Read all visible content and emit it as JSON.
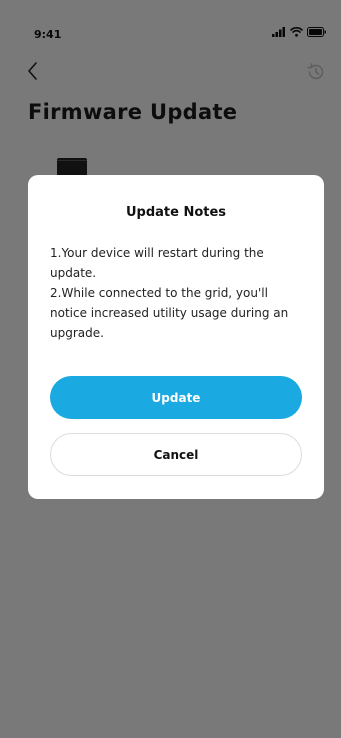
{
  "status_bar": {
    "time": "9:41",
    "icons": [
      "signal-icon",
      "wifi-icon",
      "battery-icon"
    ]
  },
  "nav": {
    "back_icon": "chevron-left-icon",
    "history_icon": "history-icon"
  },
  "page": {
    "title": "Firmware Update"
  },
  "dialog": {
    "title": "Update Notes",
    "notes": [
      "1.Your device will restart during the update.",
      "2.While connected to the grid, you'll notice increased utility usage during an upgrade."
    ],
    "update_label": "Update",
    "cancel_label": "Cancel"
  },
  "colors": {
    "accent": "#1ba9e1",
    "overlay": "rgba(0,0,0,0.5)",
    "background": "#f3f3f3"
  }
}
